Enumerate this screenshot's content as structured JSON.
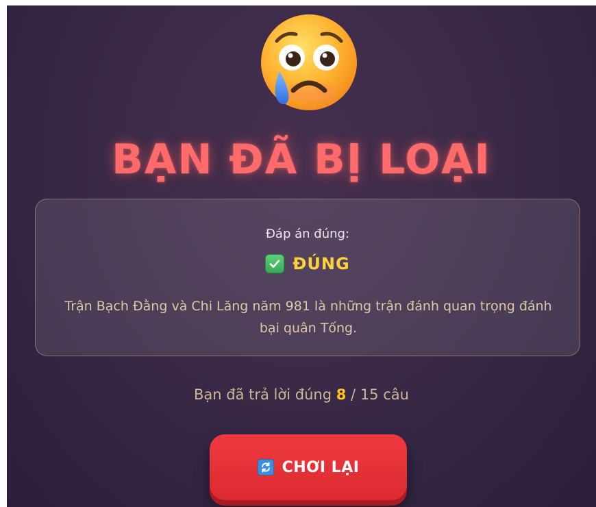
{
  "screen": {
    "title": "BẠN ĐÃ BỊ LOẠI",
    "emoji_icon": "crying-face-icon"
  },
  "answer_card": {
    "label": "Đáp án đúng:",
    "answer_icon": "check-mark-icon",
    "answer": "ĐÚNG",
    "explanation": "Trận Bạch Đằng và Chi Lăng năm 981 là những trận đánh quan trọng đánh bại quân Tống."
  },
  "score": {
    "prefix": "Bạn đã trả lời đúng",
    "correct": "8",
    "separator": "/",
    "total": "15",
    "suffix": "câu"
  },
  "replay_button": {
    "icon": "refresh-icon",
    "label": "CHƠI LẠI"
  },
  "colors": {
    "title": "#ff6b6b",
    "answer": "#ffd23a",
    "score_highlight": "#ffc21a",
    "button": "#e63237",
    "background": "#3a2a47"
  }
}
